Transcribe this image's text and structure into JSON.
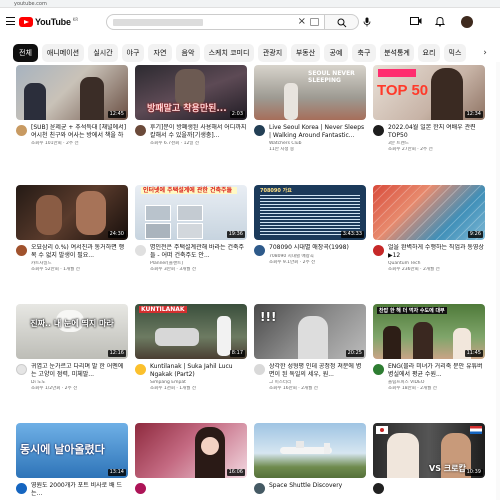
{
  "browser": {
    "url": "youtube.com"
  },
  "header": {
    "logo_text": "YouTube",
    "region": "KR",
    "search_clear_glyph": "×",
    "icons": [
      "menu-icon",
      "search-icon",
      "mic-icon",
      "create-icon",
      "bell-icon"
    ]
  },
  "chips": [
    "전체",
    "애니메이션",
    "실시간",
    "야구",
    "자연",
    "음악",
    "스케치 코미디",
    "관광지",
    "부동산",
    "공예",
    "축구",
    "분석통계",
    "요리",
    "믹스"
  ],
  "chips_next": "›",
  "videos": [
    {
      "title": "[SUB] 윤제균 + 추석특대 [채널에서] 여시천 친구와 여사는 방에서 책을 하는...",
      "channel": "조회수 101만회 · 2주 전",
      "meta": "",
      "duration": "12:45",
      "thumb_text": ""
    },
    {
      "title": "후기]문이 방폐생된 사용해서 어디까지 칼해서 수 있을까[기생충]...",
      "channel": "조회수 6.7천회 · 12일 전",
      "meta": "",
      "duration": "2:03",
      "thumb_text": "방패말고 착용만된..."
    },
    {
      "title": "Live Seoul Korea | Never Sleeps | Walking Around Fantastic...",
      "channel": "Watchers Club",
      "meta": "11만 시청 중",
      "duration": "",
      "thumb_text": "SEOUL NEVER SLEEPING"
    },
    {
      "title": "2022.04월 일본 한지 여배우 관련 TOP50",
      "channel": "3분 트렌드",
      "meta": "조회수 27만회 · 2주 전",
      "duration": "12:34",
      "thumb_text": "TOP 50"
    },
    {
      "title": "오묘삼리 0.%) 여서진과 동거하면 행복 수 없지 발생이 필요...",
      "channel": "카트차일드",
      "meta": "조회수 52만회 · 1개월 전",
      "duration": "24:30",
      "thumb_text": ""
    },
    {
      "title": "명인전은 주택설계관해 바라는 건축주들 - 어떠 건축주도 안...",
      "channel": "Planner[플랜트]",
      "meta": "조회수 3만회 · 3개월 전",
      "duration": "19:36",
      "thumb_text": "인터넷에 주택설계에 관한 건축주들"
    },
    {
      "title": "708090 시대별 애창곡(1998)",
      "channel": "708090 시대별 애창곡",
      "meta": "조회수 9.1만회 · 2주 전",
      "duration": "3:43:33",
      "thumb_text": "708090 가요"
    },
    {
      "title": "얼을 완벽하게 수행하는 직업과 동영상 ▶12",
      "channel": "Quantum Tech",
      "meta": "조회수 236만회 · 2개월 전",
      "duration": "9:26",
      "thumb_text": ""
    },
    {
      "title": "귀엽고 눈가르고 다리며 말 한 어멘에는 고양이 점력, 미체말...",
      "channel": "Di 도도",
      "meta": "조회수 1/2만회 · 2주 전",
      "duration": "12:16",
      "thumb_text": "진짜.. 내 눈에 띄지 마라"
    },
    {
      "title": "Kuntilanak | Suka Jahil Lucu Ngakak (Part2)",
      "channel": "Simpang Empat",
      "meta": "조회수 1천회 · 1개월 전",
      "duration": "8:17",
      "thumb_text": "KUNTILANAK"
    },
    {
      "title": "상각한 성형평 인데 공정정 쳐분에 병면이 된 독일의 세우, 원...",
      "channel": "그 미스터리",
      "meta": "조회수 16만회 · 2개월 전",
      "duration": "20:25",
      "thumb_text": "!!!"
    },
    {
      "title": "ENG(블라 미녀가 거리축 문안 유튜버 병실에서 평균 수원...",
      "channel": "올림프피스 VIDEO",
      "meta": "조회수 18만회 · 2개월 전",
      "duration": "11:45",
      "thumb_text": "찬밥 한 해 더 먹자 수도에 대부"
    },
    {
      "title": "영원도 2000개가 포트 비사로 배 드는...",
      "channel": "",
      "meta": "",
      "duration": "13:14",
      "thumb_text": "동시에 날아올렸다"
    },
    {
      "title": "",
      "channel": "",
      "meta": "",
      "duration": "16:06",
      "thumb_text": ""
    },
    {
      "title": "Space Shuttle Discovery",
      "channel": "",
      "meta": "",
      "duration": "",
      "thumb_text": ""
    },
    {
      "title": "",
      "channel": "",
      "meta": "",
      "duration": "10:39",
      "thumb_text": "VS 크로캅"
    }
  ],
  "colors": {
    "brand_red": "#ff0000",
    "chip_active_bg": "#0f0f0f",
    "chip_bg": "#f2f2f2",
    "text_secondary": "#606060"
  }
}
